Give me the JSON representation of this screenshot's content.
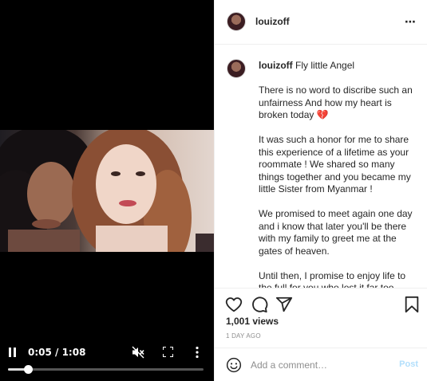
{
  "video": {
    "time_display": "0:05 / 1:08",
    "progress_fraction": 0.1,
    "icons": [
      "pause-icon",
      "mute-icon",
      "fullscreen-icon",
      "more-vertical-icon"
    ]
  },
  "post": {
    "username": "louizoff",
    "more_icon": "⋯",
    "caption": {
      "username": "louizoff",
      "first_line": "Fly little Angel",
      "paragraphs": [
        "There is no word to discribe such an unfairness And how my heart is broken today 💔",
        "It was such a honor for me to share this experience of a lifetime as your roommate ! We shared so many things together and you became my little Sister from Myanmar !",
        "We promised to meet again one day and i know that later you'll be there with my family to greet me at the gates of heaven.",
        "Until then, I promise to enjoy life to the full for you who lost it far too young !"
      ]
    },
    "views": "1,001 views",
    "time_ago": "1 DAY AGO",
    "comment": {
      "placeholder": "Add a comment…",
      "post_label": "Post"
    }
  }
}
